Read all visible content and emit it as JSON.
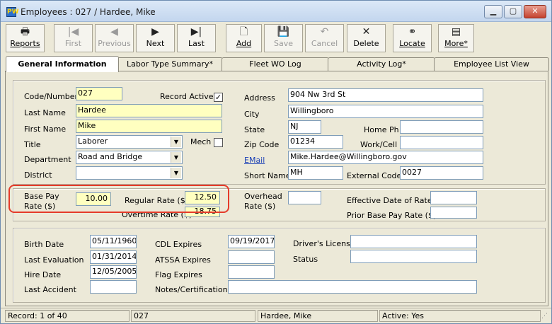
{
  "window": {
    "title": "Employees : 027 / Hardee, Mike",
    "app_icon": "PW"
  },
  "toolbar": {
    "reports": "Reports",
    "first": "First",
    "previous": "Previous",
    "next": "Next",
    "last": "Last",
    "add": "Add",
    "save": "Save",
    "cancel": "Cancel",
    "delete": "Delete",
    "locate": "Locate",
    "more": "More*"
  },
  "tabs": [
    "General Information",
    "Labor Type Summary*",
    "Fleet WO Log",
    "Activity Log*",
    "Employee List View"
  ],
  "form": {
    "code_label": "Code/Number",
    "code": "027",
    "record_active_label": "Record Active",
    "record_active": "✓",
    "last_name_label": "Last Name",
    "last_name": "Hardee",
    "first_name_label": "First Name",
    "first_name": "Mike",
    "title_label": "Title",
    "title": "Laborer",
    "mech_label": "Mech",
    "department_label": "Department",
    "department": "Road and Bridge",
    "district_label": "District",
    "district": "",
    "address_label": "Address",
    "address": "904 Nw 3rd St",
    "city_label": "City",
    "city": "Willingboro",
    "state_label": "State",
    "state": "NJ",
    "home_ph_label": "Home Ph",
    "home_ph": "",
    "zip_label": "Zip Code",
    "zip": "01234",
    "work_cell_label": "Work/Cell",
    "work_cell": "",
    "email_label": "EMail",
    "email": "Mike.Hardee@Willingboro.gov",
    "short_name_label": "Short Name",
    "short_name": "MH",
    "external_code_label": "External Code",
    "external_code": "0027"
  },
  "rates": {
    "base_pay_label_1": "Base Pay",
    "base_pay_label_2": "Rate ($)",
    "base_pay": "10.00",
    "regular_rate_label": "Regular Rate ($)",
    "regular_rate": "12.50",
    "overtime_rate_label": "Overtime Rate ($)",
    "overtime_rate": "18.75",
    "overhead_label_1": "Overhead",
    "overhead_label_2": "Rate ($)",
    "overhead": "",
    "effective_date_label": "Effective Date of Rates",
    "effective_date": "",
    "prior_base_label": "Prior Base Pay Rate ($)",
    "prior_base": ""
  },
  "dates": {
    "birth_label": "Birth Date",
    "birth": "05/11/1960",
    "cdl_label": "CDL Expires",
    "cdl": "09/19/2017",
    "drivers_license_label": "Driver's License",
    "drivers_license": "",
    "last_eval_label": "Last Evaluation",
    "last_eval": "01/31/2014",
    "atssa_label": "ATSSA Expires",
    "atssa": "",
    "status_label": "Status",
    "status": "",
    "hire_label": "Hire Date",
    "hire": "12/05/2005",
    "flag_label": "Flag Expires",
    "flag": "",
    "last_accident_label": "Last Accident",
    "last_accident": "",
    "notes_label": "Notes/Certifications",
    "notes": ""
  },
  "statusbar": {
    "record": "Record: 1 of 40",
    "code": "027",
    "name": "Hardee, Mike",
    "active": "Active: Yes"
  },
  "colors": {
    "highlight": "#e53b2a",
    "required_field": "#ffffc0",
    "link": "#1a3fb5"
  }
}
